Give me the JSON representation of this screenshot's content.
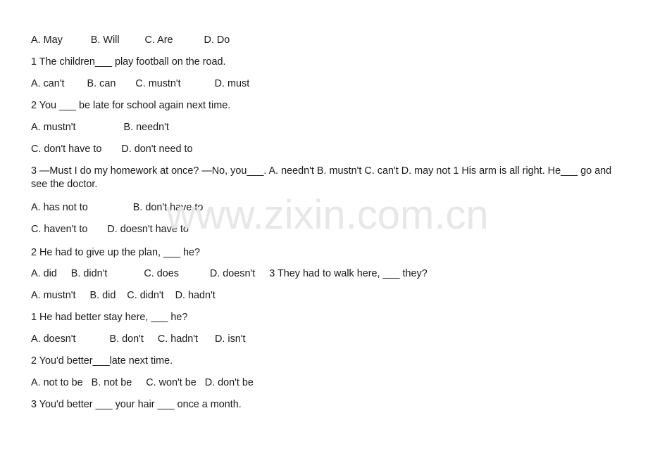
{
  "document": {
    "watermark": "www.zixin.com.cn",
    "watermark_color": "#e7e7e7",
    "background_color": "#ffffff",
    "text_color": "#1a1a1a",
    "lines": [
      {
        "id": "l1",
        "text": "A. May          B. Will         C. Are           D. Do"
      },
      {
        "id": "l2",
        "text": "1 The children___ play football on the road."
      },
      {
        "id": "l3",
        "text": "A. can't        B. can       C. mustn't            D. must"
      },
      {
        "id": "l4",
        "text": "2 You ___ be late for school again next time."
      },
      {
        "id": "l5",
        "text": "A. mustn't                 B. needn't"
      },
      {
        "id": "l6",
        "text": "C. don't have to       D. don't need to"
      },
      {
        "id": "l7a",
        "text": "3 —Must I do my homework at once? —No, you___.          A. needn't      B. mustn't      C. can't           D. may not        1 His arm is all right. He___ go and see the doctor."
      },
      {
        "id": "l8",
        "text": "A. has not to                B. don't have to"
      },
      {
        "id": "l9",
        "text": "C. haven't to       D. doesn't have to"
      },
      {
        "id": "l10",
        "text": "2 He had to give up the plan, ___ he?"
      },
      {
        "id": "l11",
        "text": "A. did     B. didn't             C. does           D. doesn't     3 They had to walk here, ___ they?"
      },
      {
        "id": "l12",
        "text": "A. mustn't     B. did    C. didn't    D. hadn't"
      },
      {
        "id": "l13",
        "text": "1 He had better stay here, ___ he?"
      },
      {
        "id": "l14",
        "text": "A. doesn't            B. don't     C. hadn't      D. isn't"
      },
      {
        "id": "l15",
        "text": "2 You'd better___late next time."
      },
      {
        "id": "l16",
        "text": "A. not to be   B. not be     C. won't be   D. don't be"
      },
      {
        "id": "l17",
        "text": "3 You'd better ___ your hair ___ once a month."
      }
    ]
  }
}
